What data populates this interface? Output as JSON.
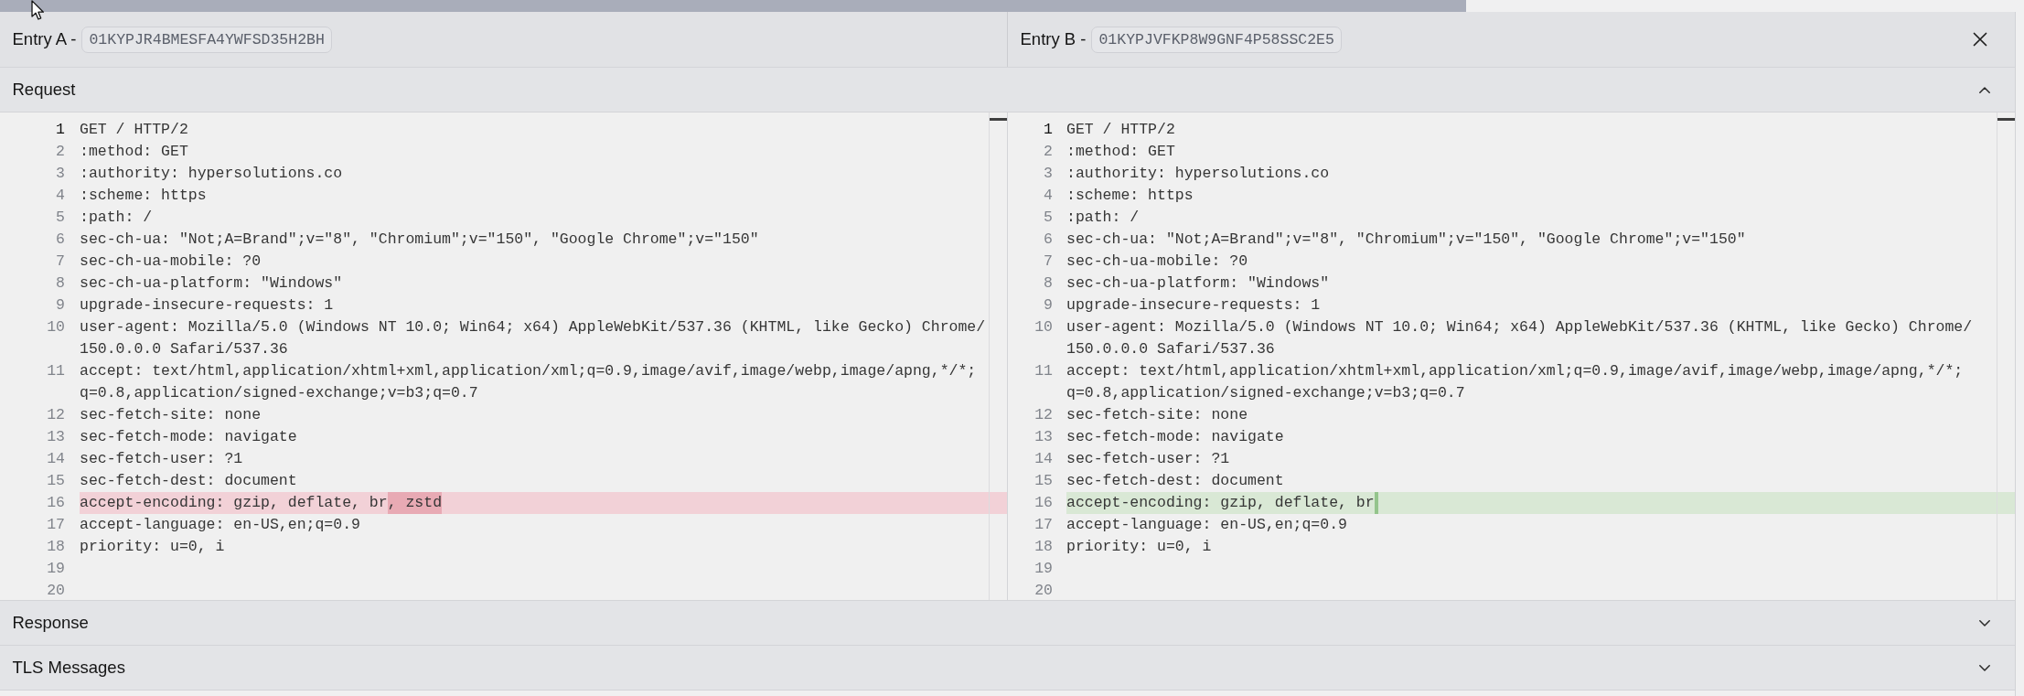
{
  "entries": [
    {
      "label": "Entry A -",
      "id": "01KYPJR4BMESFA4YWFSD35H2BH"
    },
    {
      "label": "Entry B -",
      "id": "01KYPJVFKP8W9GNF4P58SSC2E5"
    }
  ],
  "sections": [
    {
      "title": "Request",
      "expanded": true,
      "panes": [
        {
          "lines": [
            {
              "number": "1",
              "text": "GET / HTTP/2",
              "kind": "plain",
              "active": true
            },
            {
              "number": "2",
              "text": ":method: GET",
              "kind": "plain",
              "active": false
            },
            {
              "number": "3",
              "text": ":authority: hypersolutions.co",
              "kind": "plain",
              "active": false
            },
            {
              "number": "4",
              "text": ":scheme: https",
              "kind": "plain",
              "active": false
            },
            {
              "number": "5",
              "text": ":path: /",
              "kind": "plain",
              "active": false
            },
            {
              "number": "6",
              "text": "sec-ch-ua: \"Not;A=Brand\";v=\"8\", \"Chromium\";v=\"150\", \"Google Chrome\";v=\"150\"",
              "kind": "plain",
              "active": false
            },
            {
              "number": "7",
              "text": "sec-ch-ua-mobile: ?0",
              "kind": "plain",
              "active": false
            },
            {
              "number": "8",
              "text": "sec-ch-ua-platform: \"Windows\"",
              "kind": "plain",
              "active": false
            },
            {
              "number": "9",
              "text": "upgrade-insecure-requests: 1",
              "kind": "plain",
              "active": false
            },
            {
              "number": "10",
              "text": "user-agent: Mozilla/5.0 (Windows NT 10.0; Win64; x64) AppleWebKit/537.36 (KHTML, like Gecko) Chrome/",
              "continuation": "150.0.0.0 Safari/537.36",
              "kind": "plain",
              "active": false
            },
            {
              "number": "11",
              "text": "accept: text/html,application/xhtml+xml,application/xml;q=0.9,image/avif,image/webp,image/apng,*/*;",
              "continuation": "q=0.8,application/signed-exchange;v=b3;q=0.7",
              "kind": "plain",
              "active": false
            },
            {
              "number": "12",
              "text": "sec-fetch-site: none",
              "kind": "plain",
              "active": false
            },
            {
              "number": "13",
              "text": "sec-fetch-mode: navigate",
              "kind": "plain",
              "active": false
            },
            {
              "number": "14",
              "text": "sec-fetch-user: ?1",
              "kind": "plain",
              "active": false
            },
            {
              "number": "15",
              "text": "sec-fetch-dest: document",
              "kind": "plain",
              "active": false
            },
            {
              "number": "16",
              "text": "accept-encoding: gzip, deflate, br",
              "changed": ", zstd",
              "kind": "removed",
              "active": false
            },
            {
              "number": "17",
              "text": "accept-language: en-US,en;q=0.9",
              "kind": "plain",
              "active": false
            },
            {
              "number": "18",
              "text": "priority: u=0, i",
              "kind": "plain",
              "active": false
            },
            {
              "number": "19",
              "kind": "plain",
              "active": false
            },
            {
              "number": "20",
              "kind": "plain",
              "active": false
            }
          ]
        },
        {
          "lines": [
            {
              "number": "1",
              "text": "GET / HTTP/2",
              "kind": "plain",
              "active": true
            },
            {
              "number": "2",
              "text": ":method: GET",
              "kind": "plain",
              "active": false
            },
            {
              "number": "3",
              "text": ":authority: hypersolutions.co",
              "kind": "plain",
              "active": false
            },
            {
              "number": "4",
              "text": ":scheme: https",
              "kind": "plain",
              "active": false
            },
            {
              "number": "5",
              "text": ":path: /",
              "kind": "plain",
              "active": false
            },
            {
              "number": "6",
              "text": "sec-ch-ua: \"Not;A=Brand\";v=\"8\", \"Chromium\";v=\"150\", \"Google Chrome\";v=\"150\"",
              "kind": "plain",
              "active": false
            },
            {
              "number": "7",
              "text": "sec-ch-ua-mobile: ?0",
              "kind": "plain",
              "active": false
            },
            {
              "number": "8",
              "text": "sec-ch-ua-platform: \"Windows\"",
              "kind": "plain",
              "active": false
            },
            {
              "number": "9",
              "text": "upgrade-insecure-requests: 1",
              "kind": "plain",
              "active": false
            },
            {
              "number": "10",
              "text": "user-agent: Mozilla/5.0 (Windows NT 10.0; Win64; x64) AppleWebKit/537.36 (KHTML, like Gecko) Chrome/",
              "continuation": "150.0.0.0 Safari/537.36",
              "kind": "plain",
              "active": false
            },
            {
              "number": "11",
              "text": "accept: text/html,application/xhtml+xml,application/xml;q=0.9,image/avif,image/webp,image/apng,*/*;",
              "continuation": "q=0.8,application/signed-exchange;v=b3;q=0.7",
              "kind": "plain",
              "active": false
            },
            {
              "number": "12",
              "text": "sec-fetch-site: none",
              "kind": "plain",
              "active": false
            },
            {
              "number": "13",
              "text": "sec-fetch-mode: navigate",
              "kind": "plain",
              "active": false
            },
            {
              "number": "14",
              "text": "sec-fetch-user: ?1",
              "kind": "plain",
              "active": false
            },
            {
              "number": "15",
              "text": "sec-fetch-dest: document",
              "kind": "plain",
              "active": false
            },
            {
              "number": "16",
              "text": "accept-encoding: gzip, deflate, br",
              "kind": "added",
              "active": false
            },
            {
              "number": "17",
              "text": "accept-language: en-US,en;q=0.9",
              "kind": "plain",
              "active": false
            },
            {
              "number": "18",
              "text": "priority: u=0, i",
              "kind": "plain",
              "active": false
            },
            {
              "number": "19",
              "kind": "plain",
              "active": false
            },
            {
              "number": "20",
              "kind": "plain",
              "active": false
            }
          ]
        }
      ]
    },
    {
      "title": "Response",
      "expanded": false
    },
    {
      "title": "TLS Messages",
      "expanded": false
    }
  ]
}
